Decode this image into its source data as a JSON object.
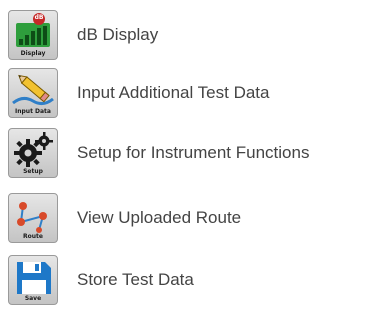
{
  "menu": {
    "items": [
      {
        "label": "dB Display",
        "icon": "db-display-icon",
        "icon_caption": "Display",
        "icon_badge": "dB"
      },
      {
        "label": "Input Additional Test Data",
        "icon": "pencil-input-icon",
        "icon_caption": "Input Data"
      },
      {
        "label": "Setup for Instrument Functions",
        "icon": "gears-setup-icon",
        "icon_caption": "Setup"
      },
      {
        "label": "View Uploaded Route",
        "icon": "route-icon",
        "icon_caption": "Route"
      },
      {
        "label": "Store Test Data",
        "icon": "floppy-save-icon",
        "icon_caption": "Save"
      }
    ]
  },
  "colors": {
    "label_text": "#444444",
    "tile_background": "#d4d4d4",
    "db_bars": "#1f8a2e",
    "db_badge": "#c62828",
    "pencil": "#f2c230",
    "gears": "#1a1a1a",
    "route_nodes": "#d84a2a",
    "route_path": "#2f7fc8",
    "floppy": "#1e78c8"
  }
}
